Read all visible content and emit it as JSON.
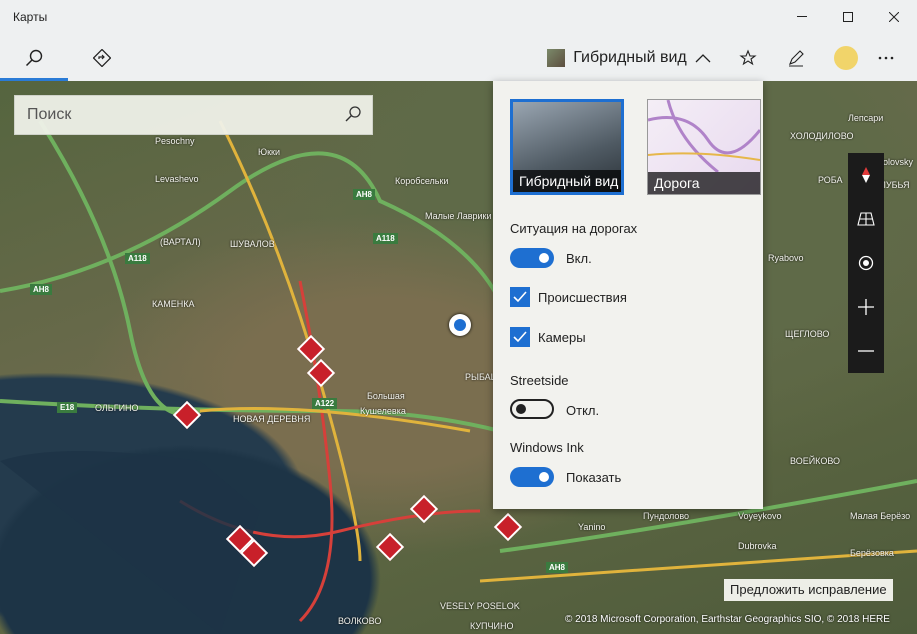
{
  "window": {
    "title": "Карты"
  },
  "toolbar": {
    "view_label": "Гибридный вид"
  },
  "search": {
    "placeholder": "Поиск"
  },
  "panel": {
    "tiles": [
      {
        "label": "Гибридный вид",
        "selected": true
      },
      {
        "label": "Дорога",
        "selected": false
      }
    ],
    "traffic": {
      "heading": "Ситуация на дорогах",
      "toggle_label": "Вкл.",
      "on": true
    },
    "checks": [
      {
        "label": "Происшествия",
        "checked": true
      },
      {
        "label": "Камеры",
        "checked": true
      }
    ],
    "streetside": {
      "heading": "Streetside",
      "toggle_label": "Откл.",
      "on": false
    },
    "ink": {
      "heading": "Windows Ink",
      "toggle_label": "Показать",
      "on": true
    }
  },
  "map": {
    "labels": [
      "Pesochny",
      "Юкки",
      "Levashevo",
      "Коробсельки",
      "Малые Лаврики",
      "ШУВАЛОВ",
      "(ВАРТАЛ)",
      "КАМЕНКА",
      "ОЛЬГИНО",
      "НОВАЯ ДЕРЕВНЯ",
      "Большая",
      "Кушелевка",
      "Yanino",
      "Пундолово",
      "Voyeykovo",
      "Dubrovka",
      "Малая Берёзо",
      "Берёзовка",
      "ЩЕГЛОВО",
      "VESELY POSELOK",
      "ВОЛКОВО",
      "КУПЧИНО",
      "Kuzmolovsky",
      "ХОЛОДИЛОВО",
      "Лепсари",
      "ЛУБЬЯ",
      "РОБА",
      "РЫБАЦКОЕ",
      "Ryabovo",
      "ВОЕЙКОВО"
    ],
    "shields": [
      "A118",
      "AH8",
      "A118",
      "AH8",
      "E18",
      "A122",
      "AH8"
    ],
    "suggest_button": "Предложить исправление",
    "copyright": "© 2018 Microsoft Corporation, Earthstar Geographics  SIO, © 2018 HERE"
  },
  "colors": {
    "accent": "#1e6fd1",
    "panel_bg": "#f2f2ee",
    "toolbar_bg": "#eef0f1"
  }
}
